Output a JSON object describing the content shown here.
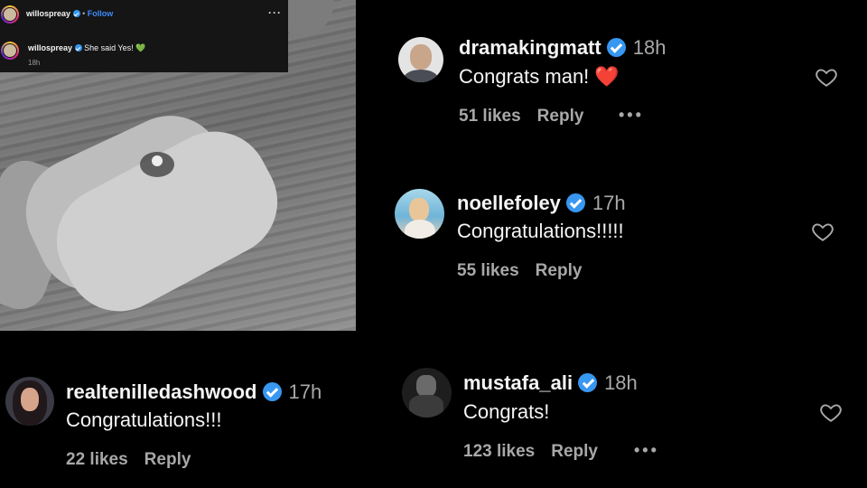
{
  "post": {
    "username": "willospreay",
    "follow_label": "Follow",
    "caption_user": "willospreay",
    "caption_text": "She said Yes!",
    "caption_emoji": "💚",
    "time": "18h",
    "more_icon": "more-horizontal-icon"
  },
  "comments": [
    {
      "username": "dramakingmatt",
      "verified": true,
      "time": "18h",
      "text": "Congrats man!",
      "emoji": "❤️",
      "likes": "51 likes",
      "reply": "Reply",
      "has_more": true
    },
    {
      "username": "noellefoley",
      "verified": true,
      "time": "17h",
      "text": "Congratulations!!!!!",
      "likes": "55 likes",
      "reply": "Reply",
      "has_more": false
    },
    {
      "username": "realtenilledashwood",
      "verified": true,
      "time": "17h",
      "text": "Congratulations!!!",
      "likes": "22 likes",
      "reply": "Reply",
      "has_more": false
    },
    {
      "username": "mustafa_ali",
      "verified": true,
      "time": "18h",
      "text": "Congrats!",
      "likes": "123 likes",
      "reply": "Reply",
      "has_more": true
    }
  ],
  "colors": {
    "background": "#000000",
    "verified": "#3897f0",
    "secondary_text": "#a8a8a8",
    "heart_emoji": "#ff3040"
  },
  "icons": [
    "verified-badge-icon",
    "heart-outline-icon",
    "more-horizontal-icon"
  ]
}
